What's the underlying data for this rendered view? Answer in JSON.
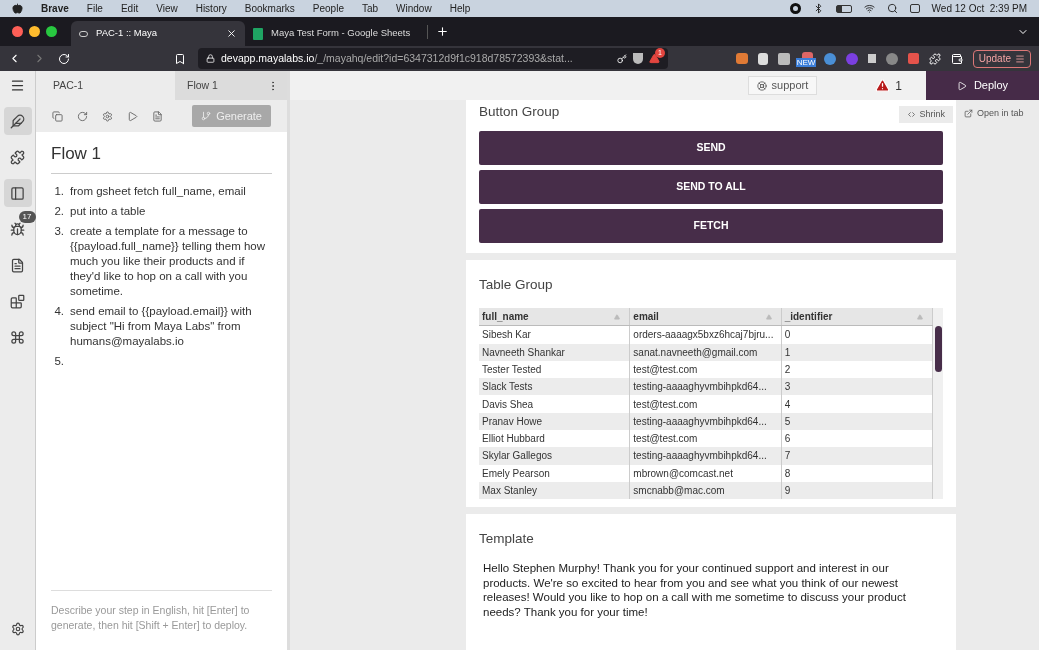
{
  "menu_bar": {
    "app": "Brave",
    "items": [
      "File",
      "Edit",
      "View",
      "History",
      "Bookmarks",
      "People",
      "Tab",
      "Window",
      "Help"
    ],
    "clock": "Wed 12 Oct  2:39 PM"
  },
  "browser": {
    "tabs": [
      {
        "title": "PAC-1 :: Maya",
        "selected": true
      },
      {
        "title": "Maya Test Form - Google Sheets",
        "selected": false
      }
    ],
    "url_host": "devapp.mayalabs.io",
    "url_path": "/_/mayahq/edit?id=6347312d9f1c918d78572393&stat...",
    "shield_badge": "1",
    "extension_badge": "NEW",
    "update_button": "Update"
  },
  "header": {
    "project": "PAC-1",
    "flow_tab": "Flow 1",
    "support": "support",
    "alerts": "1",
    "deploy": "Deploy"
  },
  "rail": {
    "items": [
      {
        "kind": "feather",
        "selected": true
      },
      {
        "kind": "puzzle",
        "selected": false
      },
      {
        "kind": "layout",
        "selected": true
      },
      {
        "kind": "bug",
        "selected": false,
        "badge": "17"
      },
      {
        "kind": "file",
        "selected": false
      },
      {
        "kind": "blocks",
        "selected": false
      },
      {
        "kind": "command",
        "selected": false
      }
    ]
  },
  "editor": {
    "generate": "Generate",
    "title": "Flow 1",
    "steps": [
      {
        "number": "1.",
        "text": "from gsheet fetch full_name, email"
      },
      {
        "number": "2.",
        "text": "put into a table"
      },
      {
        "number": "3.",
        "text": "create a template for a message to {{payload.full_name}} telling them how much you like their products and if they'd like to hop on a call with you sometime."
      },
      {
        "number": "4.",
        "text": "send email to {{payload.email}} with subject \"Hi from Maya Labs\" from humans@mayalabs.io"
      },
      {
        "number": "5."
      }
    ],
    "prompt": {
      "placeholder": "Describe your step in English, hit [Enter] to generate, then hit [Shift + Enter] to deploy."
    }
  },
  "canvas": {
    "shrink": "Shrink",
    "open_in_tab": "Open in tab",
    "button_group": {
      "title": "Button Group",
      "buttons": [
        "SEND",
        "SEND TO ALL",
        "FETCH"
      ]
    },
    "table_group": {
      "title": "Table Group",
      "columns": [
        "full_name",
        "email",
        "_identifier"
      ],
      "rows": [
        [
          "Sibesh Kar",
          "orders-aaaagx5bxz6hcaj7bjru...",
          "0"
        ],
        [
          "Navneeth Shankar",
          "sanat.navneeth@gmail.com",
          "1"
        ],
        [
          "Tester Tested",
          "test@test.com",
          "2"
        ],
        [
          "Slack Tests",
          "testing-aaaaghyvmbihpkd64...",
          "3"
        ],
        [
          "Davis Shea",
          "test@test.com",
          "4"
        ],
        [
          "Pranav Howe",
          "testing-aaaaghyvmbihpkd64...",
          "5"
        ],
        [
          "Elliot Hubbard",
          "test@test.com",
          "6"
        ],
        [
          "Skylar Gallegos",
          "testing-aaaaghyvmbihpkd64...",
          "7"
        ],
        [
          "Emely Pearson",
          "mbrown@comcast.net",
          "8"
        ],
        [
          "Max Stanley",
          "smcnabb@mac.com",
          "9"
        ]
      ]
    },
    "template": {
      "title": "Template",
      "text": "Hello Stephen Murphy! Thank you for your continued support and interest in our products. We're so excited to hear from you and see what you think of our newest releases! Would you like to hop on a call with me sometime to discuss your product needs? Thank you for your time!"
    }
  }
}
